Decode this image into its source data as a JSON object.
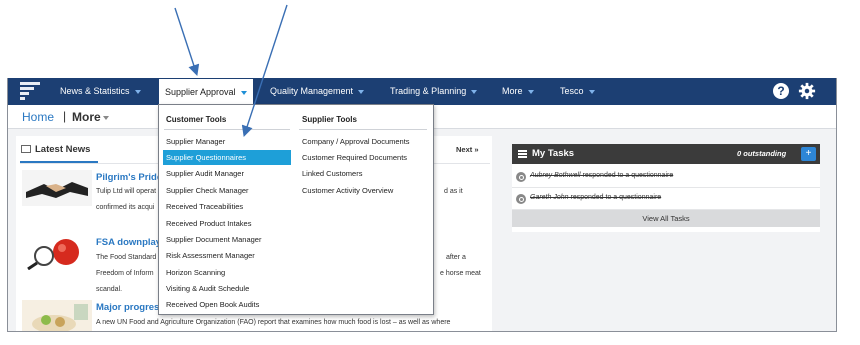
{
  "nav": {
    "items": [
      {
        "label": "News & Statistics"
      },
      {
        "label": "Supplier Approval"
      },
      {
        "label": "Quality Management"
      },
      {
        "label": "Trading & Planning"
      },
      {
        "label": "More"
      },
      {
        "label": "Tesco"
      }
    ],
    "help_label": "?"
  },
  "breadcrumb": {
    "home": "Home",
    "separator": "|",
    "more": "More"
  },
  "news": {
    "heading": "Latest News",
    "next_label": "Next »",
    "items": [
      {
        "title": "Pilgrim's Pride",
        "line1": "Tulip Ltd will operat",
        "line1_right": "d as it",
        "line2": "confirmed its acqui"
      },
      {
        "title": "FSA downplay",
        "line1": "The Food Standard",
        "line1_right": "after a",
        "line2": "Freedom of Inform",
        "line2_right": "e horse meat",
        "line3": "scandal."
      },
      {
        "title": "Major progress",
        "line1": "A new UN Food and Agriculture Organization (FAO) report that examines how much food is lost – as well as where"
      }
    ]
  },
  "tasks": {
    "title": "My Tasks",
    "outstanding": "0 outstanding",
    "add_label": "+",
    "items": [
      {
        "who": "Aubrey Bothwell",
        "action": "responded to a questionnaire"
      },
      {
        "who": "Gareth John",
        "action": "responded to a questionnaire"
      }
    ],
    "view_all": "View All Tasks"
  },
  "dropdown": {
    "col1": {
      "heading": "Customer Tools",
      "items": [
        "Supplier Manager",
        "Supplier Questionnaires",
        "Supplier Audit Manager",
        "Supplier Check Manager",
        "Received Traceabilities",
        "Received Product Intakes",
        "Supplier Document Manager",
        "Risk Assessment Manager",
        "Horizon Scanning",
        "Visiting & Audit Schedule",
        "Received Open Book Audits"
      ],
      "highlighted": "Supplier Questionnaires"
    },
    "col2": {
      "heading": "Supplier Tools",
      "items": [
        "Company / Approval Documents",
        "Customer Required Documents",
        "Linked Customers",
        "Customer Activity Overview"
      ]
    }
  },
  "colors": {
    "navbar": "#1c3f73",
    "highlight": "#1e9fd8",
    "link": "#2a78c2",
    "arrow": "#3a6fb4"
  }
}
